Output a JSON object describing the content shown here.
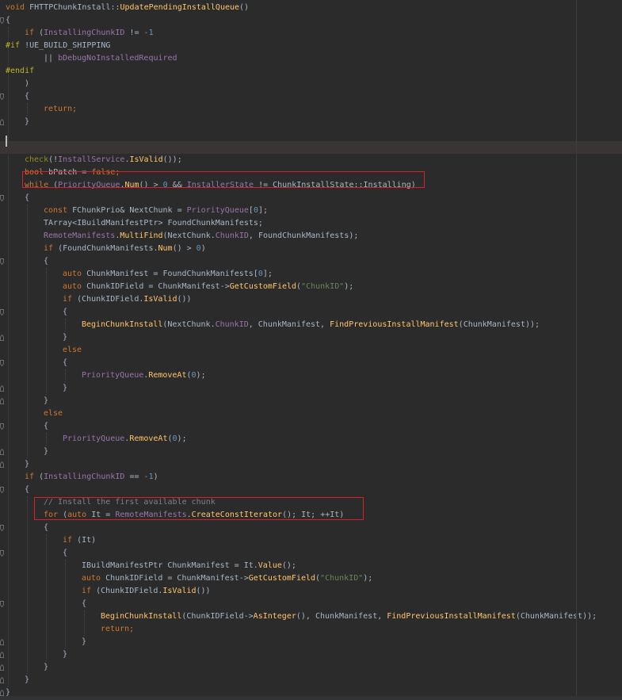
{
  "editor": {
    "language": "C++",
    "function_name": "FHTTPChunkInstall::UpdatePendingInstallQueue",
    "caret_line": 11,
    "highlighted_lines": [
      14,
      40
    ],
    "colors": {
      "background": "#2b2b2b",
      "keyword": "#cc7832",
      "number": "#6897bb",
      "string": "#6a8759",
      "preprocessor": "#bbb529",
      "member": "#9876aa",
      "function": "#ffc66d",
      "comment": "#808080",
      "text": "#a9b7c6",
      "highlight_box": "#d8202b"
    }
  },
  "lines": [
    {
      "indent": 0,
      "tokens": [
        {
          "t": "void",
          "c": "kw"
        },
        {
          "t": " FHTTPChunkInstall::",
          "c": "pl"
        },
        {
          "t": "UpdatePendingInstallQueue",
          "c": "fn"
        },
        {
          "t": "()",
          "c": "pl"
        }
      ]
    },
    {
      "indent": 0,
      "tokens": [
        {
          "t": "{",
          "c": "pl"
        }
      ]
    },
    {
      "indent": 1,
      "tokens": [
        {
          "t": "if",
          "c": "kw"
        },
        {
          "t": " (",
          "c": "pl"
        },
        {
          "t": "InstallingChunkID",
          "c": "mem"
        },
        {
          "t": " != ",
          "c": "pl"
        },
        {
          "t": "-1",
          "c": "num"
        }
      ]
    },
    {
      "indent": 0,
      "tokens": [
        {
          "t": "#if",
          "c": "pp"
        },
        {
          "t": " !UE_BUILD_SHIPPING",
          "c": "pl"
        }
      ]
    },
    {
      "indent": 2,
      "tokens": [
        {
          "t": "|| ",
          "c": "pl"
        },
        {
          "t": "bDebugNoInstalledRequired",
          "c": "mem"
        }
      ]
    },
    {
      "indent": 0,
      "tokens": [
        {
          "t": "#endif",
          "c": "pp"
        }
      ]
    },
    {
      "indent": 1,
      "tokens": [
        {
          "t": ")",
          "c": "pl"
        }
      ]
    },
    {
      "indent": 1,
      "tokens": [
        {
          "t": "{",
          "c": "pl"
        }
      ]
    },
    {
      "indent": 2,
      "tokens": [
        {
          "t": "return",
          "c": "kw"
        },
        {
          "t": ";",
          "c": "kw"
        }
      ]
    },
    {
      "indent": 1,
      "tokens": [
        {
          "t": "}",
          "c": "pl"
        }
      ]
    },
    {
      "indent": 0,
      "tokens": []
    },
    {
      "indent": 0,
      "tokens": []
    },
    {
      "indent": 1,
      "tokens": [
        {
          "t": "check",
          "c": "macro"
        },
        {
          "t": "(!",
          "c": "pl"
        },
        {
          "t": "InstallService",
          "c": "mem"
        },
        {
          "t": ".",
          "c": "pl"
        },
        {
          "t": "IsValid",
          "c": "fn"
        },
        {
          "t": "());",
          "c": "pl"
        }
      ]
    },
    {
      "indent": 1,
      "tokens": [
        {
          "t": "bool",
          "c": "kw"
        },
        {
          "t": " bPatch = ",
          "c": "pl"
        },
        {
          "t": "false",
          "c": "kw"
        },
        {
          "t": ";",
          "c": "kw"
        }
      ]
    },
    {
      "indent": 1,
      "tokens": [
        {
          "t": "while",
          "c": "kw"
        },
        {
          "t": " (",
          "c": "pl"
        },
        {
          "t": "PriorityQueue",
          "c": "mem"
        },
        {
          "t": ".",
          "c": "pl"
        },
        {
          "t": "Num",
          "c": "fn"
        },
        {
          "t": "() > ",
          "c": "pl"
        },
        {
          "t": "0",
          "c": "num"
        },
        {
          "t": " && ",
          "c": "pl"
        },
        {
          "t": "InstallerState",
          "c": "mem"
        },
        {
          "t": " != ChunkInstallState::Installing)",
          "c": "pl"
        }
      ]
    },
    {
      "indent": 1,
      "tokens": [
        {
          "t": "{",
          "c": "pl"
        }
      ]
    },
    {
      "indent": 2,
      "tokens": [
        {
          "t": "const",
          "c": "kw"
        },
        {
          "t": " FChunkPrio& NextChunk = ",
          "c": "pl"
        },
        {
          "t": "PriorityQueue",
          "c": "mem"
        },
        {
          "t": "[",
          "c": "pl"
        },
        {
          "t": "0",
          "c": "num"
        },
        {
          "t": "];",
          "c": "pl"
        }
      ]
    },
    {
      "indent": 2,
      "tokens": [
        {
          "t": "TArray<IBuildManifestPtr> FoundChunkManifests;",
          "c": "pl"
        }
      ]
    },
    {
      "indent": 2,
      "tokens": [
        {
          "t": "RemoteManifests",
          "c": "mem"
        },
        {
          "t": ".",
          "c": "pl"
        },
        {
          "t": "MultiFind",
          "c": "fn"
        },
        {
          "t": "(NextChunk.",
          "c": "pl"
        },
        {
          "t": "ChunkID",
          "c": "mem"
        },
        {
          "t": ", FoundChunkManifests);",
          "c": "pl"
        }
      ]
    },
    {
      "indent": 2,
      "tokens": [
        {
          "t": "if",
          "c": "kw"
        },
        {
          "t": " (FoundChunkManifests.",
          "c": "pl"
        },
        {
          "t": "Num",
          "c": "fn"
        },
        {
          "t": "() > ",
          "c": "pl"
        },
        {
          "t": "0",
          "c": "num"
        },
        {
          "t": ")",
          "c": "pl"
        }
      ]
    },
    {
      "indent": 2,
      "tokens": [
        {
          "t": "{",
          "c": "pl"
        }
      ]
    },
    {
      "indent": 3,
      "tokens": [
        {
          "t": "auto",
          "c": "kw"
        },
        {
          "t": " ChunkManifest = FoundChunkManifests[",
          "c": "pl"
        },
        {
          "t": "0",
          "c": "num"
        },
        {
          "t": "];",
          "c": "pl"
        }
      ]
    },
    {
      "indent": 3,
      "tokens": [
        {
          "t": "auto",
          "c": "kw"
        },
        {
          "t": " ChunkIDField = ChunkManifest->",
          "c": "pl"
        },
        {
          "t": "GetCustomField",
          "c": "fn"
        },
        {
          "t": "(",
          "c": "pl"
        },
        {
          "t": "\"ChunkID\"",
          "c": "str"
        },
        {
          "t": ");",
          "c": "pl"
        }
      ]
    },
    {
      "indent": 3,
      "tokens": [
        {
          "t": "if",
          "c": "kw"
        },
        {
          "t": " (ChunkIDField.",
          "c": "pl"
        },
        {
          "t": "IsValid",
          "c": "fn"
        },
        {
          "t": "())",
          "c": "pl"
        }
      ]
    },
    {
      "indent": 3,
      "tokens": [
        {
          "t": "{",
          "c": "pl"
        }
      ]
    },
    {
      "indent": 4,
      "tokens": [
        {
          "t": "BeginChunkInstall",
          "c": "fn"
        },
        {
          "t": "(NextChunk.",
          "c": "pl"
        },
        {
          "t": "ChunkID",
          "c": "mem"
        },
        {
          "t": ", ChunkManifest, ",
          "c": "pl"
        },
        {
          "t": "FindPreviousInstallManifest",
          "c": "fn"
        },
        {
          "t": "(ChunkManifest));",
          "c": "pl"
        }
      ]
    },
    {
      "indent": 3,
      "tokens": [
        {
          "t": "}",
          "c": "pl"
        }
      ]
    },
    {
      "indent": 3,
      "tokens": [
        {
          "t": "else",
          "c": "kw"
        }
      ]
    },
    {
      "indent": 3,
      "tokens": [
        {
          "t": "{",
          "c": "pl"
        }
      ]
    },
    {
      "indent": 4,
      "tokens": [
        {
          "t": "PriorityQueue",
          "c": "mem"
        },
        {
          "t": ".",
          "c": "pl"
        },
        {
          "t": "RemoveAt",
          "c": "fn"
        },
        {
          "t": "(",
          "c": "pl"
        },
        {
          "t": "0",
          "c": "num"
        },
        {
          "t": ");",
          "c": "pl"
        }
      ]
    },
    {
      "indent": 3,
      "tokens": [
        {
          "t": "}",
          "c": "pl"
        }
      ]
    },
    {
      "indent": 2,
      "tokens": [
        {
          "t": "}",
          "c": "pl"
        }
      ]
    },
    {
      "indent": 2,
      "tokens": [
        {
          "t": "else",
          "c": "kw"
        }
      ]
    },
    {
      "indent": 2,
      "tokens": [
        {
          "t": "{",
          "c": "pl"
        }
      ]
    },
    {
      "indent": 3,
      "tokens": [
        {
          "t": "PriorityQueue",
          "c": "mem"
        },
        {
          "t": ".",
          "c": "pl"
        },
        {
          "t": "RemoveAt",
          "c": "fn"
        },
        {
          "t": "(",
          "c": "pl"
        },
        {
          "t": "0",
          "c": "num"
        },
        {
          "t": ");",
          "c": "pl"
        }
      ]
    },
    {
      "indent": 2,
      "tokens": [
        {
          "t": "}",
          "c": "pl"
        }
      ]
    },
    {
      "indent": 1,
      "tokens": [
        {
          "t": "}",
          "c": "pl"
        }
      ]
    },
    {
      "indent": 1,
      "tokens": [
        {
          "t": "if",
          "c": "kw"
        },
        {
          "t": " (",
          "c": "pl"
        },
        {
          "t": "InstallingChunkID",
          "c": "mem"
        },
        {
          "t": " == ",
          "c": "pl"
        },
        {
          "t": "-1",
          "c": "num"
        },
        {
          "t": ")",
          "c": "pl"
        }
      ]
    },
    {
      "indent": 1,
      "tokens": [
        {
          "t": "{",
          "c": "pl"
        }
      ]
    },
    {
      "indent": 2,
      "tokens": [
        {
          "t": "// Install the first available chunk",
          "c": "cm"
        }
      ]
    },
    {
      "indent": 2,
      "tokens": [
        {
          "t": "for",
          "c": "kw"
        },
        {
          "t": " (",
          "c": "pl"
        },
        {
          "t": "auto",
          "c": "kw"
        },
        {
          "t": " It = ",
          "c": "pl"
        },
        {
          "t": "RemoteManifests",
          "c": "mem"
        },
        {
          "t": ".",
          "c": "pl"
        },
        {
          "t": "CreateConstIterator",
          "c": "fn"
        },
        {
          "t": "(); It; ++It)",
          "c": "pl"
        }
      ]
    },
    {
      "indent": 2,
      "tokens": [
        {
          "t": "{",
          "c": "pl"
        }
      ]
    },
    {
      "indent": 3,
      "tokens": [
        {
          "t": "if",
          "c": "kw"
        },
        {
          "t": " (It)",
          "c": "pl"
        }
      ]
    },
    {
      "indent": 3,
      "tokens": [
        {
          "t": "{",
          "c": "pl"
        }
      ]
    },
    {
      "indent": 4,
      "tokens": [
        {
          "t": "IBuildManifestPtr ChunkManifest = It.",
          "c": "pl"
        },
        {
          "t": "Value",
          "c": "fn"
        },
        {
          "t": "();",
          "c": "pl"
        }
      ]
    },
    {
      "indent": 4,
      "tokens": [
        {
          "t": "auto",
          "c": "kw"
        },
        {
          "t": " ChunkIDField = ChunkManifest->",
          "c": "pl"
        },
        {
          "t": "GetCustomField",
          "c": "fn"
        },
        {
          "t": "(",
          "c": "pl"
        },
        {
          "t": "\"ChunkID\"",
          "c": "str"
        },
        {
          "t": ");",
          "c": "pl"
        }
      ]
    },
    {
      "indent": 4,
      "tokens": [
        {
          "t": "if",
          "c": "kw"
        },
        {
          "t": " (ChunkIDField.",
          "c": "pl"
        },
        {
          "t": "IsValid",
          "c": "fn"
        },
        {
          "t": "())",
          "c": "pl"
        }
      ]
    },
    {
      "indent": 4,
      "tokens": [
        {
          "t": "{",
          "c": "pl"
        }
      ]
    },
    {
      "indent": 5,
      "tokens": [
        {
          "t": "BeginChunkInstall",
          "c": "fn"
        },
        {
          "t": "(ChunkIDField->",
          "c": "pl"
        },
        {
          "t": "AsInteger",
          "c": "fn"
        },
        {
          "t": "(), ChunkManifest, ",
          "c": "pl"
        },
        {
          "t": "FindPreviousInstallManifest",
          "c": "fn"
        },
        {
          "t": "(ChunkManifest));",
          "c": "pl"
        }
      ]
    },
    {
      "indent": 5,
      "tokens": [
        {
          "t": "return",
          "c": "kw"
        },
        {
          "t": ";",
          "c": "kw"
        }
      ]
    },
    {
      "indent": 4,
      "tokens": [
        {
          "t": "}",
          "c": "pl"
        }
      ]
    },
    {
      "indent": 3,
      "tokens": [
        {
          "t": "}",
          "c": "pl"
        }
      ]
    },
    {
      "indent": 2,
      "tokens": [
        {
          "t": "}",
          "c": "pl"
        }
      ]
    },
    {
      "indent": 1,
      "tokens": [
        {
          "t": "}",
          "c": "pl"
        }
      ]
    },
    {
      "indent": 0,
      "tokens": [
        {
          "t": "}",
          "c": "pl"
        }
      ]
    }
  ]
}
